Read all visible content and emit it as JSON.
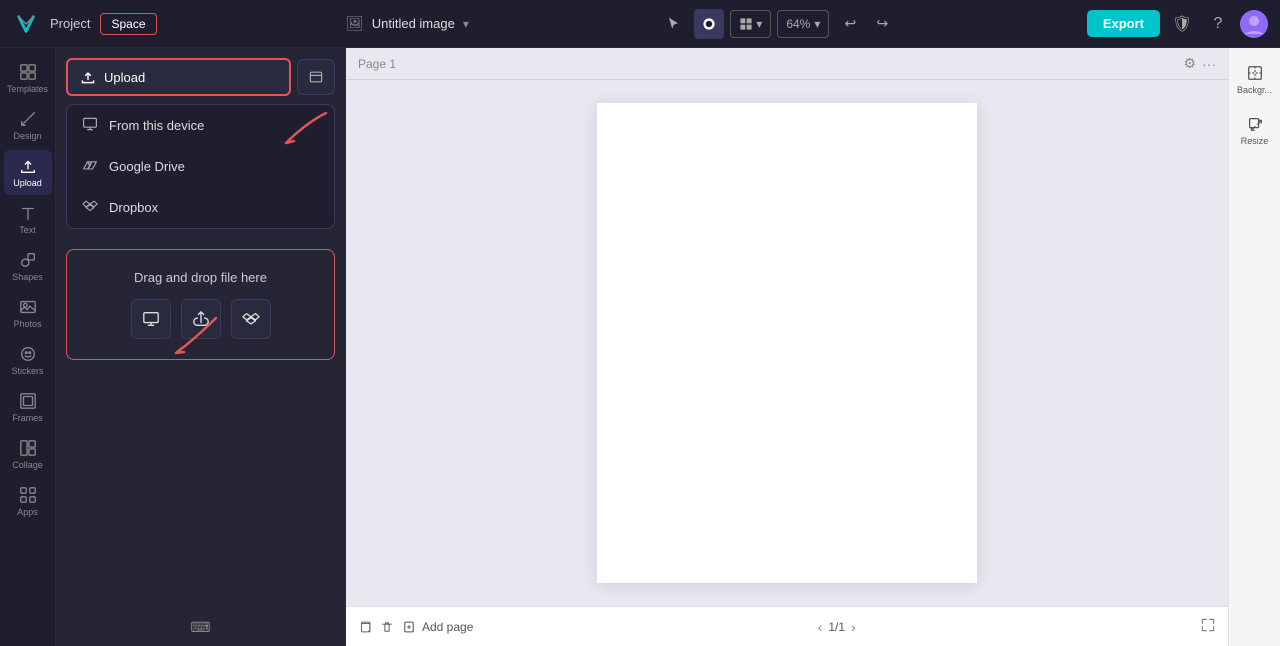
{
  "topbar": {
    "project_label": "Project",
    "space_label": "Space",
    "doc_title": "Untitled image",
    "zoom_level": "64%",
    "export_label": "Export"
  },
  "nav": {
    "items": [
      {
        "id": "templates",
        "label": "Templates",
        "icon": "grid"
      },
      {
        "id": "design",
        "label": "Design",
        "icon": "pen"
      },
      {
        "id": "upload",
        "label": "Upload",
        "icon": "upload",
        "active": true
      },
      {
        "id": "text",
        "label": "Text",
        "icon": "text"
      },
      {
        "id": "shapes",
        "label": "Shapes",
        "icon": "shapes"
      },
      {
        "id": "photos",
        "label": "Photos",
        "icon": "image"
      },
      {
        "id": "stickers",
        "label": "Stickers",
        "icon": "sticker"
      },
      {
        "id": "frames",
        "label": "Frames",
        "icon": "frame"
      },
      {
        "id": "collage",
        "label": "Collage",
        "icon": "collage"
      },
      {
        "id": "apps",
        "label": "Apps",
        "icon": "apps"
      }
    ]
  },
  "upload": {
    "button_label": "Upload",
    "dropdown_items": [
      {
        "id": "device",
        "label": "From this device",
        "icon": "monitor"
      },
      {
        "id": "gdrive",
        "label": "Google Drive",
        "icon": "gdrive"
      },
      {
        "id": "dropbox",
        "label": "Dropbox",
        "icon": "dropbox"
      }
    ],
    "drag_label": "Drag and drop file here"
  },
  "canvas": {
    "page_label": "Page 1"
  },
  "bottom": {
    "add_page_label": "Add page",
    "page_count": "1/1"
  },
  "right_panel": {
    "background_label": "Backgr...",
    "resize_label": "Resize"
  }
}
